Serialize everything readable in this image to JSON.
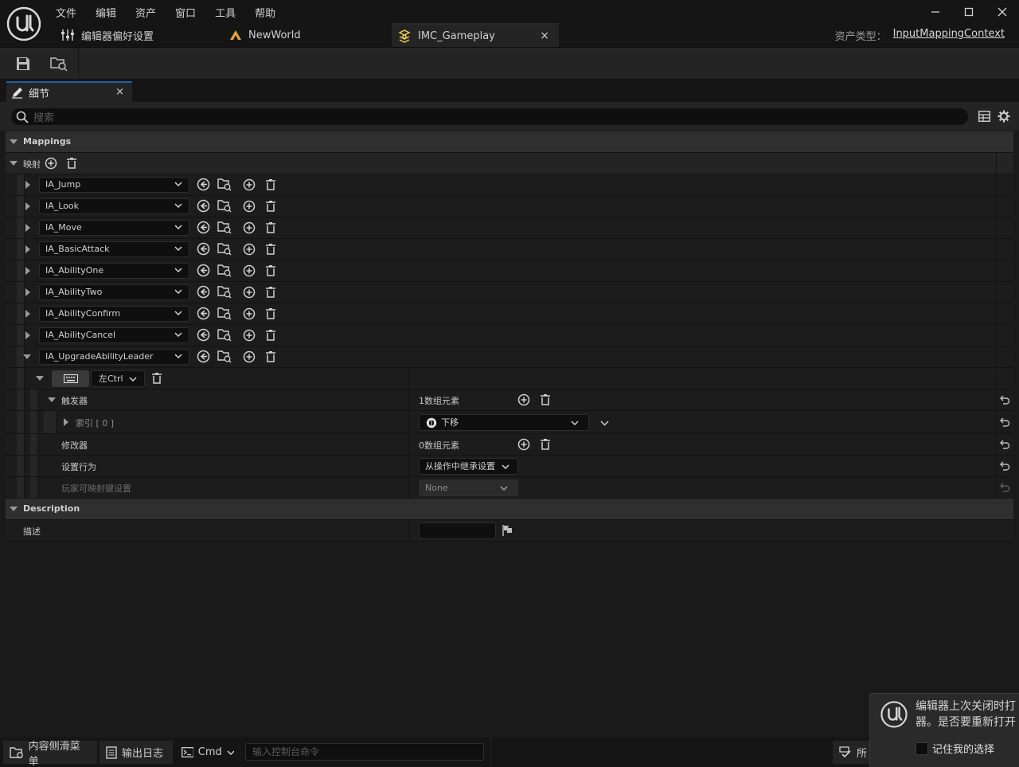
{
  "menu": [
    "文件",
    "编辑",
    "资产",
    "窗口",
    "工具",
    "帮助"
  ],
  "tabs": [
    {
      "label": "编辑器偏好设置",
      "icon": "sliders-icon"
    },
    {
      "label": "NewWorld",
      "icon": "level-icon"
    },
    {
      "label": "IMC_Gameplay",
      "icon": "input-mapping-icon",
      "active": true
    }
  ],
  "asset_type": {
    "label": "资产类型：",
    "value": "InputMappingContext"
  },
  "panel": {
    "tab_label": "细节",
    "close": "×"
  },
  "search": {
    "placeholder": "搜索"
  },
  "mappings": {
    "category": "Mappings",
    "array_label": "映射",
    "actions": [
      "IA_Jump",
      "IA_Look",
      "IA_Move",
      "IA_BasicAttack",
      "IA_AbilityOne",
      "IA_AbilityTwo",
      "IA_AbilityConfirm",
      "IA_AbilityCancel",
      "IA_UpgradeAbilityLeader"
    ],
    "expanded": {
      "key": "左Ctrl",
      "triggers_label": "触发器",
      "triggers_value": "1数组元素",
      "index_label": "索引 [ 0 ]",
      "index_value": "下移",
      "modifiers_label": "修改器",
      "modifiers_value": "0数组元素",
      "setting_behavior_label": "设置行为",
      "setting_behavior_value": "从操作中继承设置",
      "player_mappable_label": "玩家可映射键设置",
      "player_mappable_value": "None"
    }
  },
  "description": {
    "category": "Description",
    "label": "描述",
    "value": ""
  },
  "status": {
    "content_drawer": "内容侧滑菜单",
    "output_log": "输出日志",
    "cmd": "Cmd",
    "console_placeholder": "输入控制台命令",
    "source_control": "所"
  },
  "toast": {
    "message": "编辑器上次关闭时打开了以下资产编辑器。是否要重新打开它们？",
    "line1": "编辑器上次关闭时打",
    "line2": "器。是否要重新打开",
    "checkbox": "记住我的选择"
  },
  "colors": {
    "accent": "#1e5fa8",
    "level_icon": "#e8a33c",
    "imc_icon": "#e8c84a"
  }
}
